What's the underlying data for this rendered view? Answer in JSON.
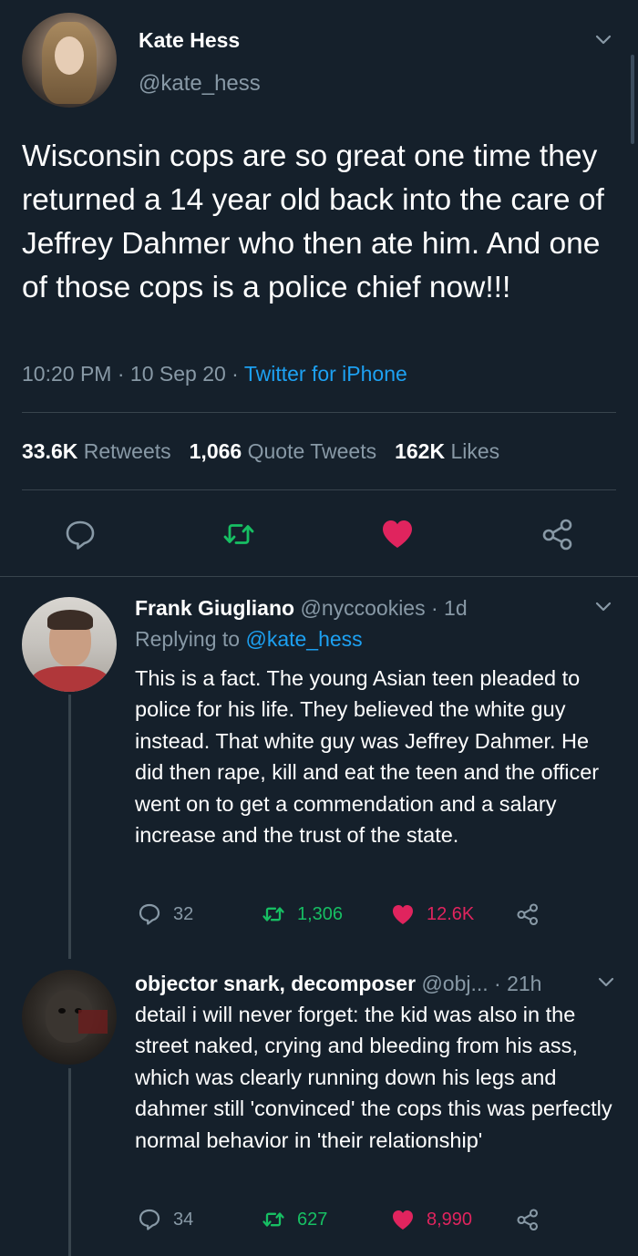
{
  "main_tweet": {
    "display_name": "Kate Hess",
    "handle": "@kate_hess",
    "text": "Wisconsin cops are so great one time they returned a 14 year old back into the care of Jeffrey Dahmer who then ate him. And one of those cops is a police chief now!!!",
    "time": "10:20 PM",
    "date": "10 Sep 20",
    "separator": "·",
    "source": "Twitter for iPhone",
    "stats": {
      "retweets_count": "33.6K",
      "retweets_label": "Retweets",
      "quotes_count": "1,066",
      "quotes_label": "Quote Tweets",
      "likes_count": "162K",
      "likes_label": "Likes"
    },
    "liked": true
  },
  "replies": [
    {
      "display_name": "Frank Giugliano",
      "handle": "@nyccookies",
      "age": "· 1d",
      "replying_prefix": "Replying to",
      "replying_to": "@kate_hess",
      "text": "This is a fact. The young Asian teen pleaded to police for his life. They believed the white guy instead. That white guy was Jeffrey Dahmer. He did then rape, kill and eat the teen and the officer went on to get a commendation and a salary increase and the trust of the state.",
      "replies_count": "32",
      "retweets_count": "1,306",
      "likes_count": "12.6K",
      "liked": true
    },
    {
      "display_name": "objector snark, decomposer",
      "handle": "@obj...",
      "age": "· 21h",
      "text": "detail i will never forget:  the kid was also in the street naked, crying and bleeding from his ass, which was clearly running down his legs and dahmer still 'convinced' the cops this was perfectly normal behavior in 'their relationship'",
      "replies_count": "34",
      "retweets_count": "627",
      "likes_count": "8,990",
      "liked": true
    }
  ],
  "colors": {
    "background": "#15202b",
    "text": "#ffffff",
    "secondary": "#8899a6",
    "link": "#1da1f2",
    "retweet": "#17bf63",
    "like": "#e0245e",
    "divider": "#38444d"
  },
  "icons": [
    "chevron-down-icon",
    "reply-icon",
    "retweet-icon",
    "heart-icon",
    "share-icon"
  ]
}
